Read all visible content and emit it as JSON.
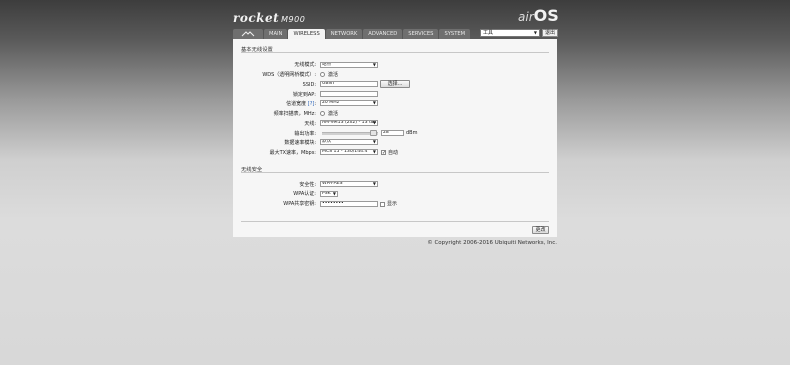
{
  "header": {
    "brand": "rocket",
    "model": "M900",
    "os_air": "air",
    "os_name": "OS"
  },
  "tabs": [
    {
      "label": "",
      "icon": "ubiquiti-logo-icon"
    },
    {
      "label": "MAIN"
    },
    {
      "label": "WIRELESS",
      "active": true
    },
    {
      "label": "NETWORK"
    },
    {
      "label": "ADVANCED"
    },
    {
      "label": "SERVICES"
    },
    {
      "label": "SYSTEM"
    }
  ],
  "tools": {
    "value": "工具"
  },
  "logout_label": "退出",
  "basic": {
    "title": "基本无线设置",
    "mode_label": "无线模式:",
    "mode_value": "站点",
    "wds_label": "WDS（透明网桥模式）:",
    "wds_option": "激活",
    "ssid_label": "SSID:",
    "ssid_value": "UBNT",
    "select_label": "选择...",
    "lock_ap_label": "锁定到AP:",
    "lock_ap_value": "",
    "channel_width_label": "信道宽度",
    "channel_width_q": "[?]",
    "channel_width_value": "20 MHz",
    "scan_label": "频率扫描表，MHz:",
    "scan_option": "激活",
    "antenna_label": "天线:",
    "antenna_value": "AM-9M13 (2x2) - 13 dBi",
    "power_label": "输出功率:",
    "power_value": "28",
    "power_unit": "dBm",
    "power_level": 0.92,
    "rate_algo_label": "数据速率模块:",
    "rate_algo_value": "默认",
    "max_rate_label": "最大TX速率，Mbps:",
    "max_rate_value": "MCS 15 - 130/144.4",
    "auto_label": "自动"
  },
  "security": {
    "title": "无线安全",
    "security_label": "安全性:",
    "security_value": "WPA-AES",
    "auth_label": "WPA认证:",
    "auth_value": "PSK",
    "key_label": "WPA共享密钥:",
    "key_value": "••••••••",
    "show_label": "显示"
  },
  "change_label": "更改",
  "copyright": "© Copyright 2006-2016 Ubiquiti Networks, Inc."
}
